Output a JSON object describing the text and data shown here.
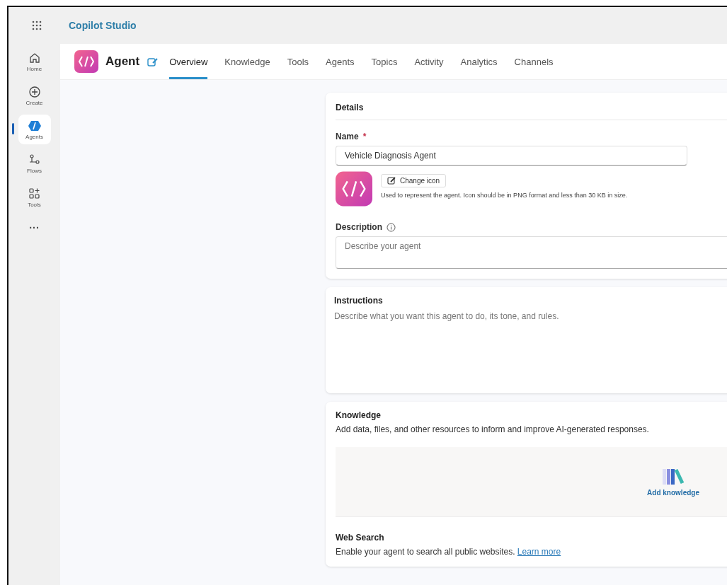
{
  "app_title": "Copilot Studio",
  "nav": [
    {
      "label": "Home",
      "kind": "home",
      "selected": false
    },
    {
      "label": "Create",
      "kind": "create",
      "selected": false
    },
    {
      "label": "Agents",
      "kind": "agents",
      "selected": true
    },
    {
      "label": "Flows",
      "kind": "flows",
      "selected": false
    },
    {
      "label": "Tools",
      "kind": "tools",
      "selected": false
    }
  ],
  "nav_more": "...",
  "agent_name": "Agent",
  "tabs": [
    {
      "label": "Overview",
      "selected": true
    },
    {
      "label": "Knowledge",
      "selected": false
    },
    {
      "label": "Tools",
      "selected": false
    },
    {
      "label": "Agents",
      "selected": false
    },
    {
      "label": "Topics",
      "selected": false
    },
    {
      "label": "Activity",
      "selected": false
    },
    {
      "label": "Analytics",
      "selected": false
    },
    {
      "label": "Channels",
      "selected": false
    }
  ],
  "details": {
    "title": "Details",
    "name_label": "Name",
    "required_mark": "*",
    "name_value": "Vehicle Diagnosis Agent",
    "change_icon": "Change icon",
    "icon_hint": "Used to represent the agent. Icon should be in PNG format and less than 30 KB in size.",
    "description_label": "Description",
    "description_placeholder": "Describe your agent"
  },
  "instructions": {
    "title": "Instructions",
    "placeholder": "Describe what you want this agent to do, its tone, and rules."
  },
  "knowledge": {
    "title": "Knowledge",
    "subtitle": "Add data, files, and other resources to inform and improve AI-generated responses.",
    "add_label": "Add knowledge"
  },
  "web_search": {
    "title": "Web Search",
    "text": "Enable your agent to search all public websites.",
    "link": "Learn more"
  }
}
